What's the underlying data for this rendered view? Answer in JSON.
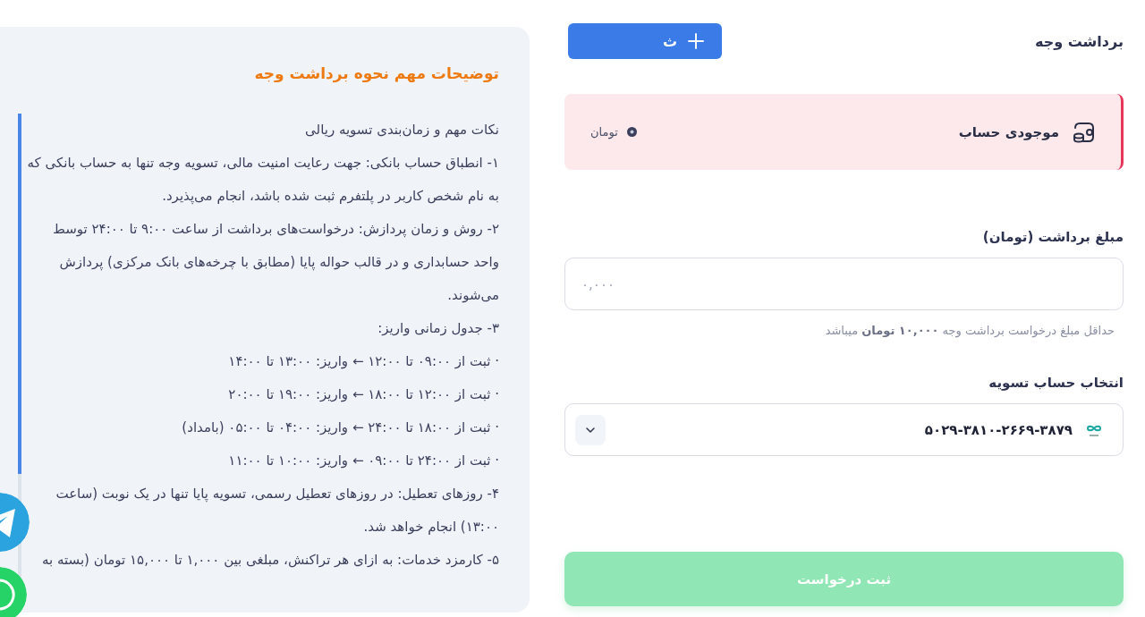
{
  "header": {
    "title": "برداشت وجه",
    "action_button": {
      "label": "ث"
    }
  },
  "balance_card": {
    "title": "موجودی حساب",
    "currency": "تومان"
  },
  "amount_field": {
    "label": "مبلغ برداشت (تومان)",
    "placeholder": "۰,۰۰۰",
    "hint": "حداقل مبلغ درخواست برداشت وجه **۱۰,۰۰۰ تومان** میباشد"
  },
  "account_field": {
    "label": "انتخاب حساب تسویه",
    "value": "۵۰۲۹-۳۸۱۰-۲۶۶۹-۳۸۷۹"
  },
  "submit_button": {
    "label": "ثبت درخواست",
    "disabled": true
  },
  "info_panel": {
    "title": "توضیحات مهم نحوه برداشت وجه",
    "paragraphs": [
      "نکات مهم و زمان‌بندی تسویه ریالی",
      "۱- انطباق حساب بانکی: جهت رعایت امنیت مالی، تسویه وجه تنها به حساب بانکی که به نام شخص کاربر در پلتفرم ثبت شده باشد، انجام می‌پذیرد.",
      "۲- روش و زمان پردازش: درخواست‌های برداشت از ساعت ۹:۰۰ تا ۲۴:۰۰ توسط واحد حسابداری و در قالب حواله پایا (مطابق با چرخه‌های بانک مرکزی) پردازش می‌شوند.",
      "۳- جدول زمانی واریز:",
      "· ثبت از ۰۹:۰۰ تا ۱۲:۰۰ ← واریز: ۱۳:۰۰ تا ۱۴:۰۰",
      "· ثبت از ۱۲:۰۰ تا ۱۸:۰۰ ← واریز: ۱۹:۰۰ تا ۲۰:۰۰",
      "· ثبت از ۱۸:۰۰ تا ۲۴:۰۰ ← واریز: ۰۴:۰۰ تا ۰۵:۰۰ (بامداد)",
      "· ثبت از ۲۴:۰۰ تا ۰۹:۰۰ ← واریز: ۱۰:۰۰ تا ۱۱:۰۰",
      "۴- روزهای تعطیل: در روزهای تعطیل رسمی، تسویه پایا تنها در یک نوبت (ساعت ۱۳:۰۰) انجام خواهد شد.",
      "۵- کارمزد خدمات: به ازای هر تراکنش، مبلغی بین ۱,۰۰۰ تا ۱۵,۰۰۰ تومان (بسته به"
    ]
  }
}
